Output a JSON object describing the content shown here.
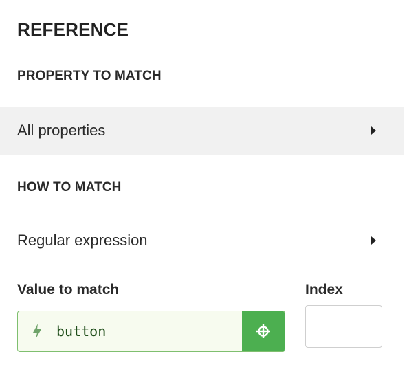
{
  "panel": {
    "title": "REFERENCE"
  },
  "property_to_match": {
    "label": "PROPERTY TO MATCH",
    "selected": "All properties"
  },
  "how_to_match": {
    "label": "HOW TO MATCH",
    "selected": "Regular expression"
  },
  "value_to_match": {
    "label": "Value to match",
    "value": "button",
    "icon": "bolt-icon",
    "action_icon": "crosshair-icon"
  },
  "index": {
    "label": "Index",
    "value": ""
  },
  "colors": {
    "accent_green": "#4caf50",
    "input_border": "#7fbf6f",
    "input_bg": "#f7fbef",
    "selected_row_bg": "#f1f1f1"
  }
}
